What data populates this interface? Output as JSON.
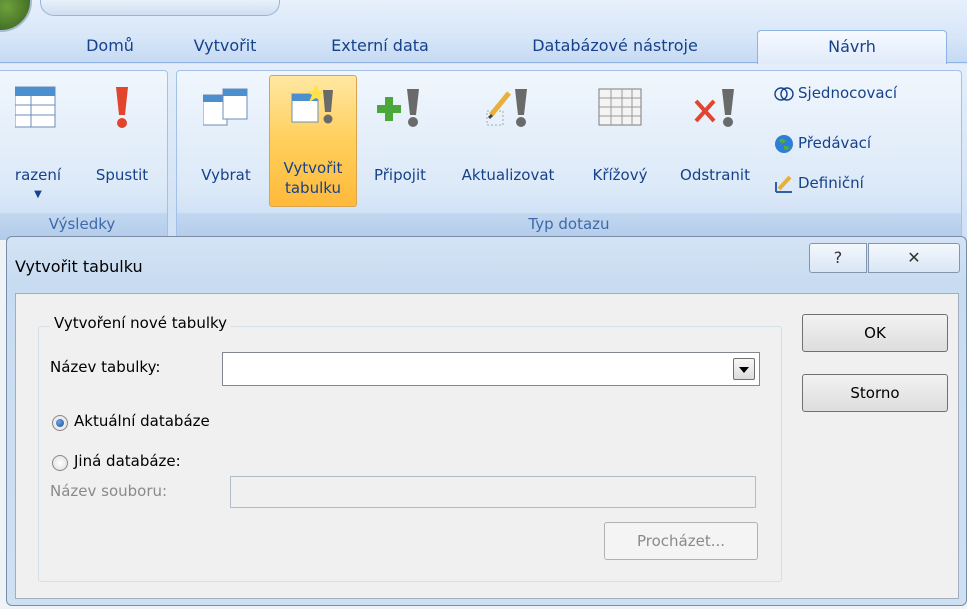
{
  "ribbon": {
    "tabs": [
      "Domů",
      "Vytvořit",
      "Externí data",
      "Databázové nástroje",
      "Návrh"
    ],
    "active_tab": "Návrh",
    "results_group": {
      "caption": "Výsledky",
      "buttons": [
        "razení",
        "Spustit"
      ]
    },
    "query_type_group": {
      "caption": "Typ dotazu",
      "buttons": [
        "Vybrat",
        "Vytvořit tabulku",
        "Připojit",
        "Aktualizovat",
        "Křížový",
        "Odstranit"
      ],
      "selected": "Vytvořit tabulku",
      "small_buttons": [
        "Sjednocovací",
        "Předávací",
        "Definiční"
      ]
    }
  },
  "dialog": {
    "title": "Vytvořit tabulku",
    "help_glyph": "?",
    "close_glyph": "✕",
    "group_title": "Vytvoření nové tabulky",
    "table_name_label": "Název tabulky:",
    "table_name_value": "",
    "radio_current": "Aktuální databáze",
    "radio_other": "Jiná databáze:",
    "selected_option": "Aktuální databáze",
    "file_name_label": "Název souboru:",
    "file_name_value": "",
    "browse_button": "Procházet...",
    "ok_button": "OK",
    "cancel_button": "Storno"
  },
  "colors": {
    "ribbon_text": "#15428b",
    "selected_button": "#ffcf5b",
    "dialog_frame": "#c8dcf1"
  },
  "icons": [
    "table-icon",
    "exclamation-icon",
    "make-table-icon",
    "append-icon",
    "update-icon",
    "crosstab-icon",
    "delete-icon",
    "union-icon",
    "globe-icon",
    "definition-icon",
    "help-icon",
    "close-icon",
    "dropdown-arrow-icon"
  ]
}
